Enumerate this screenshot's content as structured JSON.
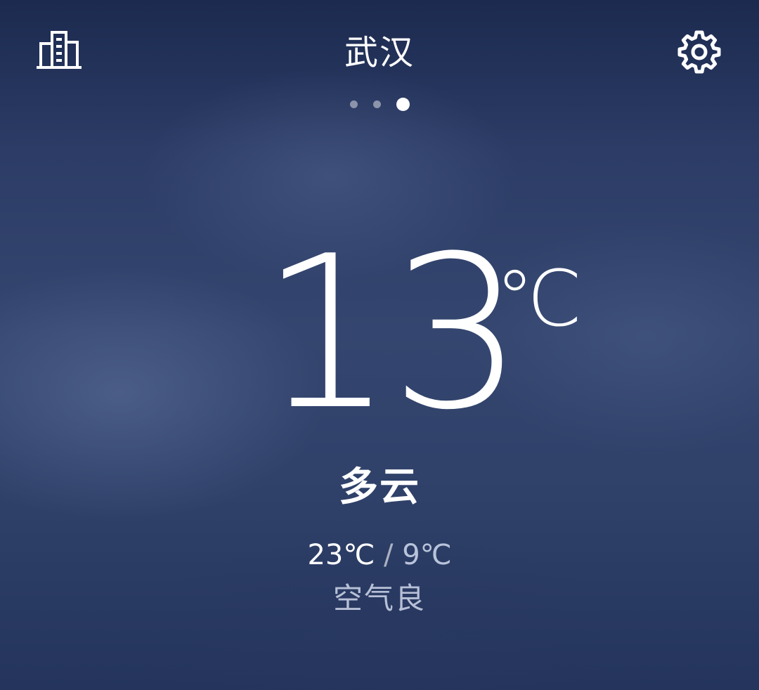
{
  "header": {
    "city": "武汉",
    "left_icon": "city-list-icon",
    "right_icon": "gear-icon"
  },
  "pager": {
    "total_pages": 3,
    "active_index": 2
  },
  "current": {
    "temperature": "13",
    "unit": "℃",
    "condition": "多云",
    "high": "23℃",
    "separator": "/",
    "low": "9℃",
    "air_quality": "空气良"
  },
  "colors": {
    "background_top": "#1c2a4f",
    "background_mid": "#34466f",
    "text_primary": "#ffffff"
  }
}
